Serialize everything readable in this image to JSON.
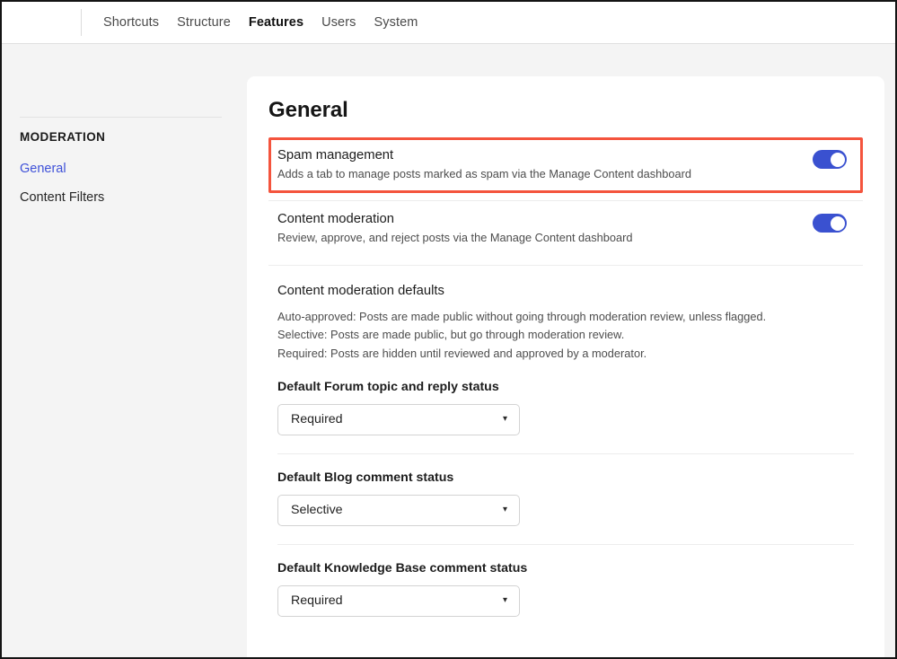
{
  "topbar": {
    "tabs": [
      {
        "label": "Shortcuts",
        "active": false
      },
      {
        "label": "Structure",
        "active": false
      },
      {
        "label": "Features",
        "active": true
      },
      {
        "label": "Users",
        "active": false
      },
      {
        "label": "System",
        "active": false
      }
    ]
  },
  "sidebar": {
    "heading": "MODERATION",
    "items": [
      {
        "label": "General",
        "active": true
      },
      {
        "label": "Content Filters",
        "active": false
      }
    ]
  },
  "main": {
    "title": "General",
    "features": [
      {
        "name": "Spam management",
        "description": "Adds a tab to manage posts marked as spam via the Manage Content dashboard",
        "toggle_state": "on",
        "highlighted": true
      },
      {
        "name": "Content moderation",
        "description": "Review, approve, and reject posts via the Manage Content dashboard",
        "toggle_state": "on",
        "highlighted": false
      }
    ],
    "defaults": {
      "title": "Content moderation defaults",
      "lines": [
        "Auto-approved: Posts are made public without going through moderation review, unless flagged.",
        "Selective: Posts are made public, but go through moderation review.",
        "Required: Posts are hidden until reviewed and approved by a moderator."
      ]
    },
    "selects": [
      {
        "label": "Default Forum topic and reply status",
        "value": "Required"
      },
      {
        "label": "Default Blog comment status",
        "value": "Selective"
      },
      {
        "label": "Default Knowledge Base comment status",
        "value": "Required"
      }
    ],
    "caret_glyph": "▾"
  },
  "colors": {
    "toggle_on": "#3a51d0",
    "highlight_border": "#f4543d",
    "link_active": "#3f51d8",
    "page_bg": "#f4f4f4",
    "card_bg": "#ffffff"
  }
}
